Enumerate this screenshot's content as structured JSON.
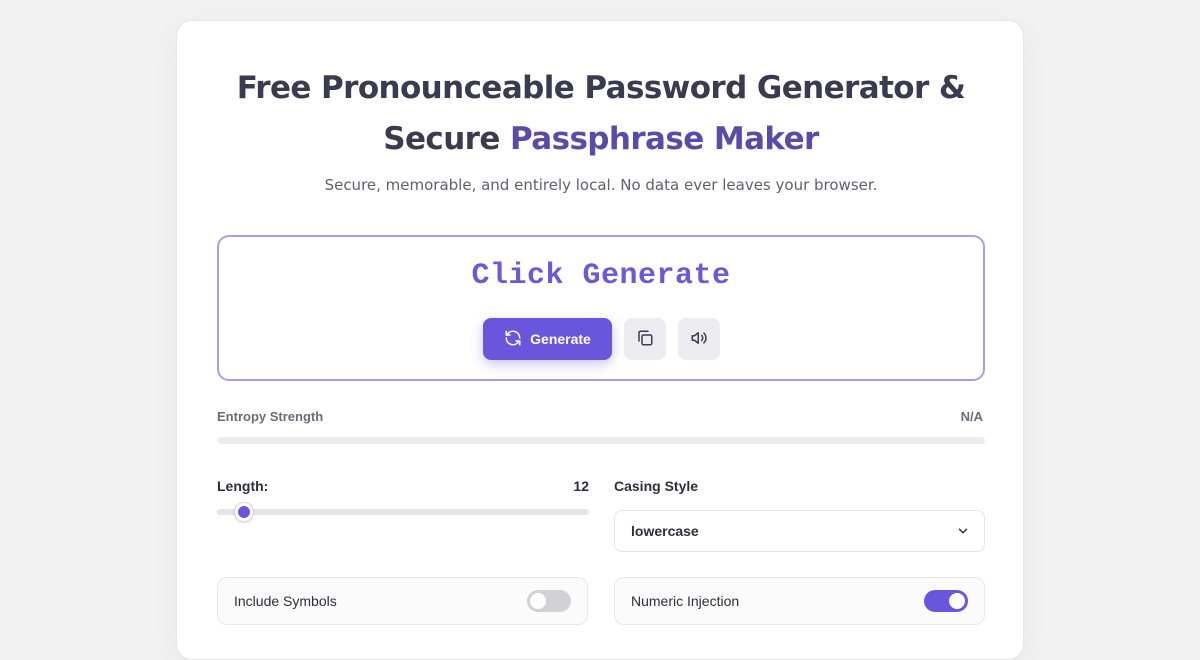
{
  "header": {
    "title_part1": "Free Pronounceable Password Generator & Secure",
    "title_part2": "Passphrase Maker",
    "subtitle": "Secure, memorable, and entirely local. No data ever leaves your browser."
  },
  "output": {
    "password_text": "Click Generate",
    "generate_label": "Generate",
    "generate_icon": "refresh-icon",
    "copy_icon": "copy-icon",
    "speak_icon": "speaker-icon"
  },
  "entropy": {
    "label": "Entropy Strength",
    "value": "N/A",
    "fill_fraction": 0
  },
  "settings": {
    "length_label": "Length:",
    "length_value": "12",
    "length_min": 8,
    "length_max": 64,
    "casing_label": "Casing Style",
    "casing_selected": "lowercase",
    "toggles": [
      {
        "label": "Include Symbols",
        "on": false
      },
      {
        "label": "Numeric Injection",
        "on": true
      }
    ]
  },
  "colors": {
    "accent": "#6a56dc",
    "title_dark": "#3b3b4f",
    "title_accent": "#5b4ba8",
    "toggle_off": "#d2d2d6"
  }
}
